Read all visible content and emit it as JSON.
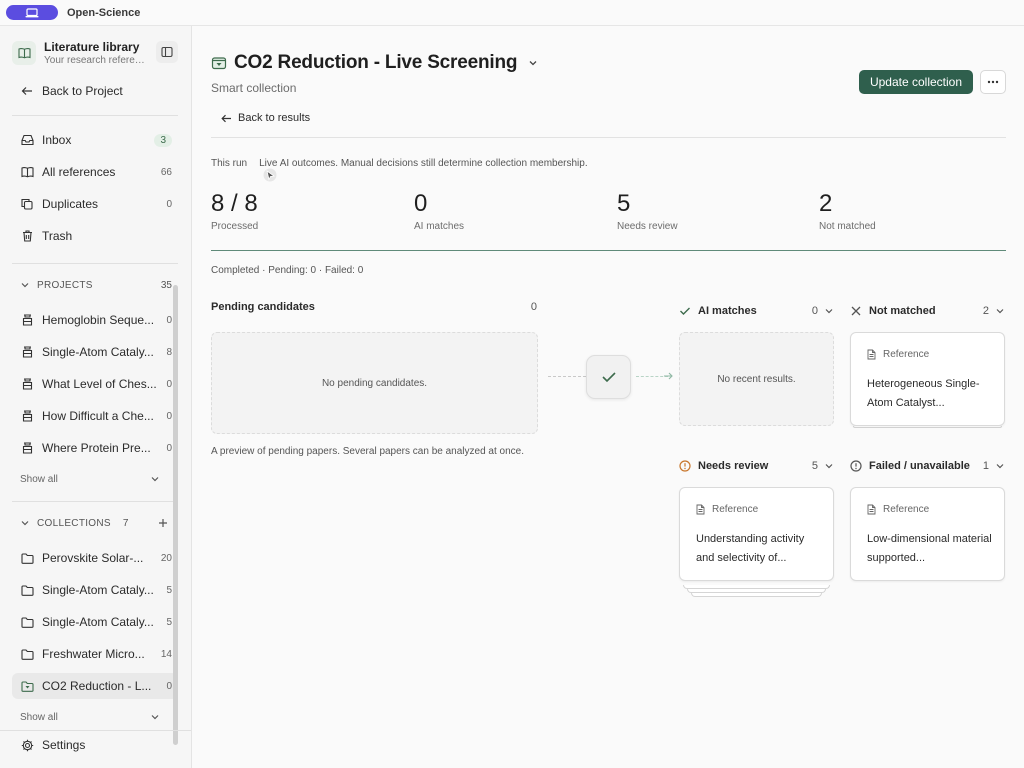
{
  "app": {
    "name": "Open-Science"
  },
  "sidebar": {
    "library": {
      "title": "Literature library",
      "subtitle": "Your research references"
    },
    "back_to_project": "Back to Project",
    "nav": [
      {
        "label": "Inbox",
        "count": "3"
      },
      {
        "label": "All references",
        "count": "66"
      },
      {
        "label": "Duplicates",
        "count": "0"
      },
      {
        "label": "Trash",
        "count": ""
      }
    ],
    "projects": {
      "heading": "PROJECTS",
      "count": "35",
      "items": [
        {
          "label": "Hemoglobin Seque...",
          "count": "0"
        },
        {
          "label": "Single-Atom Cataly...",
          "count": "8"
        },
        {
          "label": "What Level of Ches...",
          "count": "0"
        },
        {
          "label": "How Difficult a Che...",
          "count": "0"
        },
        {
          "label": "Where Protein Pre...",
          "count": "0"
        }
      ],
      "show_all": "Show all"
    },
    "collections": {
      "heading": "COLLECTIONS",
      "count": "7",
      "items": [
        {
          "label": "Perovskite Solar-...",
          "count": "20"
        },
        {
          "label": "Single-Atom Cataly...",
          "count": "5"
        },
        {
          "label": "Single-Atom Cataly...",
          "count": "5"
        },
        {
          "label": "Freshwater Micro...",
          "count": "14"
        },
        {
          "label": "CO2 Reduction - L...",
          "count": "0"
        }
      ],
      "show_all": "Show all"
    },
    "settings": "Settings"
  },
  "header": {
    "title": "CO2 Reduction - Live Screening",
    "subtitle": "Smart collection",
    "update_button": "Update collection",
    "back_to_results": "Back to results"
  },
  "run": {
    "label": "This run",
    "description": "Live AI outcomes. Manual decisions still determine collection membership.",
    "stats": [
      {
        "value": "8 / 8",
        "label": "Processed"
      },
      {
        "value": "0",
        "label": "AI matches"
      },
      {
        "value": "5",
        "label": "Needs review"
      },
      {
        "value": "2",
        "label": "Not matched"
      }
    ],
    "status": "Completed · Pending: 0 · Failed: 0"
  },
  "pending": {
    "title": "Pending candidates",
    "count": "0",
    "empty": "No pending candidates.",
    "note": "A preview of pending papers. Several papers can be analyzed at once."
  },
  "columns": {
    "ai_matches": {
      "title": "AI matches",
      "count": "0",
      "empty": "No recent results."
    },
    "not_matched": {
      "title": "Not matched",
      "count": "2",
      "card": {
        "type": "Reference",
        "title": "Heterogeneous Single-Atom Catalyst..."
      }
    },
    "needs_review": {
      "title": "Needs review",
      "count": "5",
      "card": {
        "type": "Reference",
        "title": "Understanding activity and selectivity of..."
      }
    },
    "failed": {
      "title": "Failed / unavailable",
      "count": "1",
      "card": {
        "type": "Reference",
        "title": "Low-dimensional material supported..."
      }
    }
  },
  "colors": {
    "accent": "#2f5f4d",
    "brand": "#5b4de0",
    "warning": "#c8762b"
  }
}
